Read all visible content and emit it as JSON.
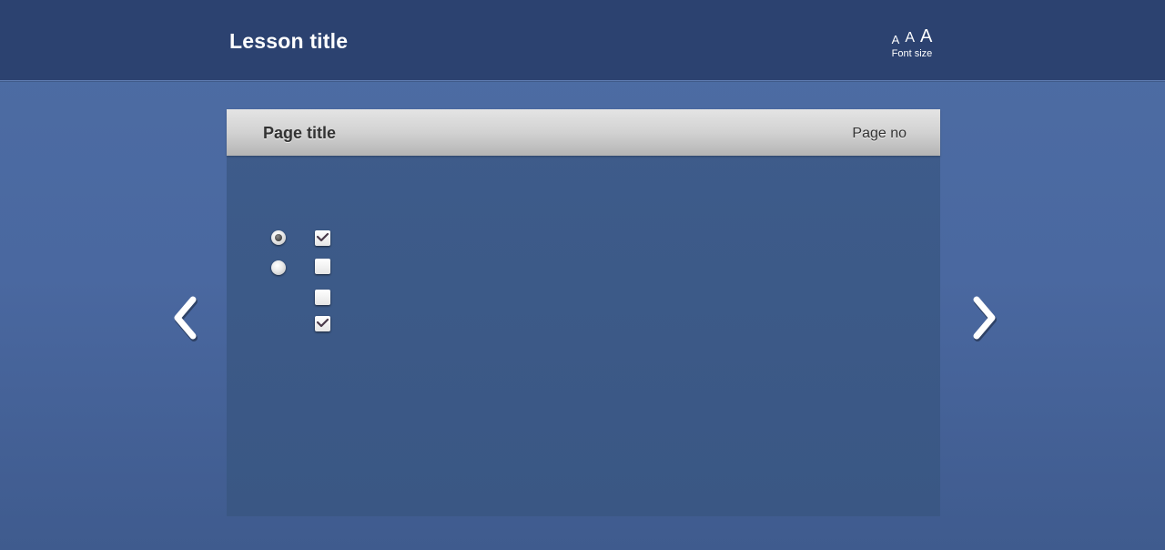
{
  "header": {
    "lesson_title": "Lesson title",
    "font_size": {
      "small_label": "A",
      "medium_label": "A",
      "large_label": "A",
      "caption": "Font size"
    }
  },
  "page": {
    "title": "Page title",
    "page_no": "Page no"
  },
  "form": {
    "radios": [
      {
        "checked": true
      },
      {
        "checked": false
      }
    ],
    "checkboxes": [
      {
        "checked": true
      },
      {
        "checked": false
      },
      {
        "checked": false
      },
      {
        "checked": true
      }
    ]
  },
  "navigation": {
    "prev_icon": "chevron-left-icon",
    "next_icon": "chevron-right-icon"
  },
  "colors": {
    "header_bg": "#2c4270",
    "page_bg": "#4a68a0",
    "panel_bg": "#3c5a8a"
  }
}
